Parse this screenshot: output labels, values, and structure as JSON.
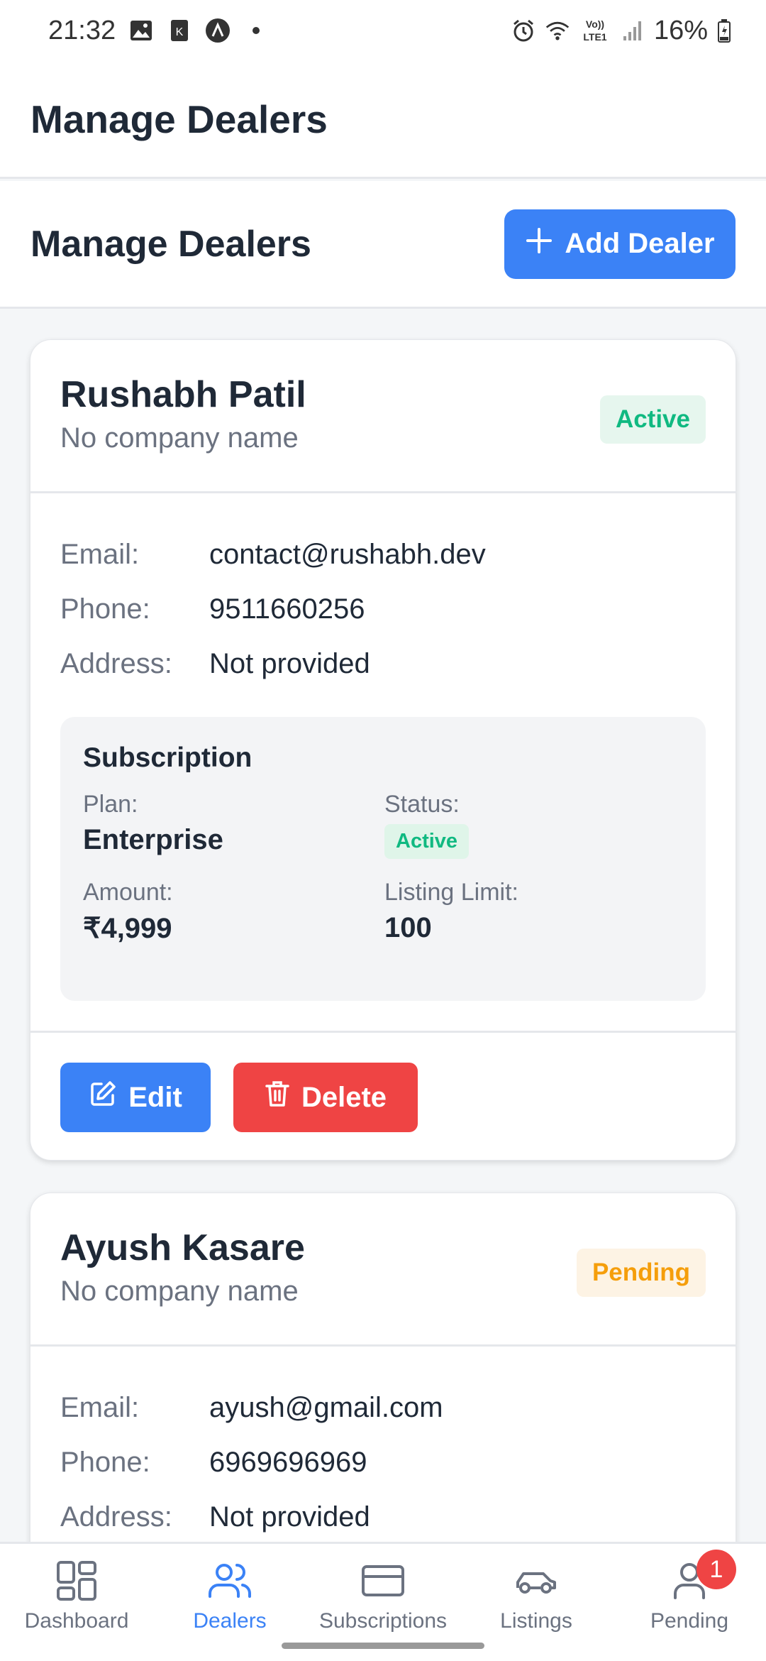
{
  "status_bar": {
    "time": "21:32",
    "battery": "16%",
    "icons_left": [
      "image-icon",
      "k-app-icon",
      "a-app-icon",
      "dot-icon"
    ],
    "icons_right": [
      "alarm-icon",
      "wifi-icon",
      "volte-icon",
      "signal-icon",
      "battery-icon"
    ],
    "volte_text": "Vo))\nLTE1"
  },
  "header": {
    "title": "Manage Dealers"
  },
  "subheader": {
    "title": "Manage Dealers",
    "add_button_label": "Add Dealer"
  },
  "colors": {
    "primary": "#3b82f6",
    "danger": "#ef4444",
    "success": "#10b981",
    "warning": "#f59e0b"
  },
  "labels": {
    "email": "Email:",
    "phone": "Phone:",
    "address": "Address:"
  },
  "dealers": [
    {
      "name": "Rushabh Patil",
      "company": "No company name",
      "status": "Active",
      "email": "contact@rushabh.dev",
      "phone": "9511660256",
      "address": "Not provided",
      "subscription": {
        "title": "Subscription",
        "plan_label": "Plan:",
        "plan": "Enterprise",
        "status_label": "Status:",
        "status": "Active",
        "amount_label": "Amount:",
        "amount": "₹4,999",
        "limit_label": "Listing Limit:",
        "limit": "100"
      },
      "edit_label": "Edit",
      "delete_label": "Delete"
    },
    {
      "name": "Ayush Kasare",
      "company": "No company name",
      "status": "Pending",
      "email": "ayush@gmail.com",
      "phone": "6969696969",
      "address": "Not provided"
    }
  ],
  "bottom_nav": [
    {
      "label": "Dashboard",
      "icon": "dashboard-icon",
      "active": false
    },
    {
      "label": "Dealers",
      "icon": "users-icon",
      "active": true
    },
    {
      "label": "Subscriptions",
      "icon": "credit-card-icon",
      "active": false
    },
    {
      "label": "Listings",
      "icon": "car-icon",
      "active": false
    },
    {
      "label": "Pending",
      "icon": "user-icon",
      "active": false,
      "badge": "1"
    }
  ]
}
